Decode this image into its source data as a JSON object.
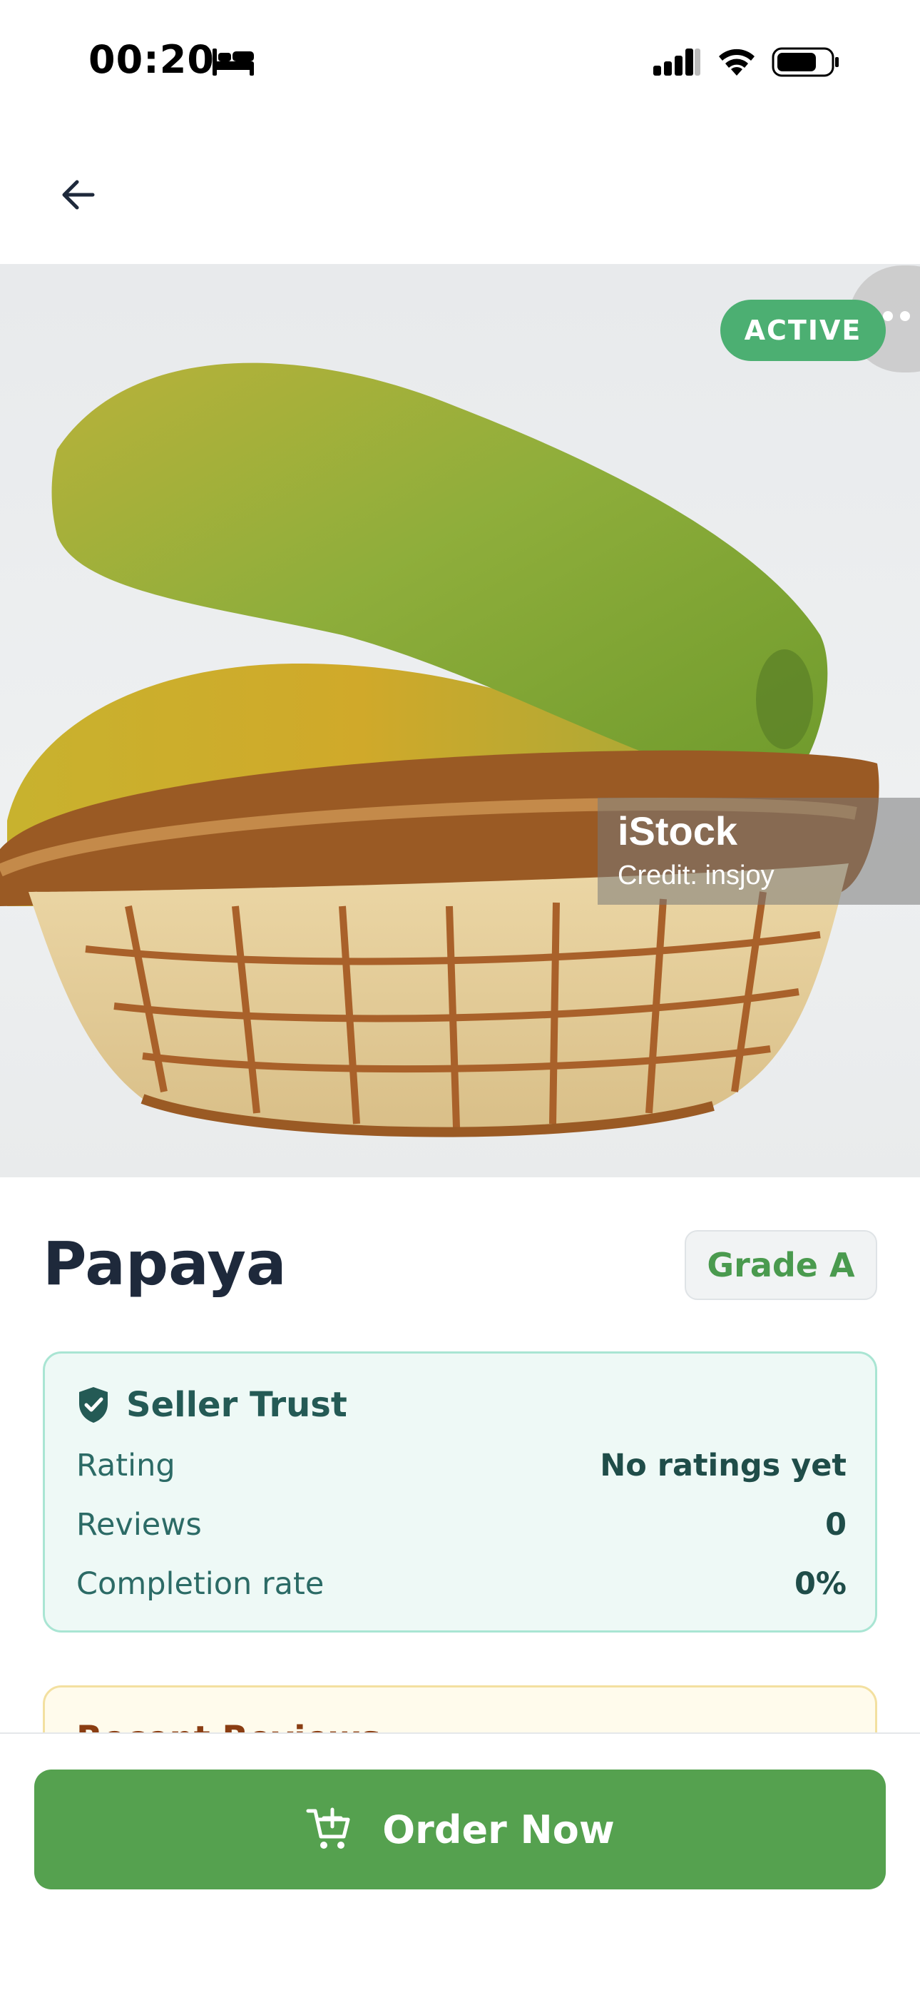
{
  "status_bar": {
    "time": "00:20",
    "icons": [
      "bed-icon",
      "signal-icon",
      "wifi-icon",
      "battery-icon"
    ]
  },
  "header": {
    "back_icon": "arrow-left-icon"
  },
  "product": {
    "image_badge": "ACTIVE",
    "more_icon": "more-dots-icon",
    "watermark_brand": "iStock",
    "watermark_credit": "Credit: insjoy",
    "name": "Papaya",
    "grade": "Grade A"
  },
  "seller_trust": {
    "title": "Seller Trust",
    "icon": "shield-check-icon",
    "rows": [
      {
        "label": "Rating",
        "value": "No ratings yet"
      },
      {
        "label": "Reviews",
        "value": "0"
      },
      {
        "label": "Completion rate",
        "value": "0%"
      }
    ]
  },
  "reviews": {
    "title": "Recent Reviews"
  },
  "footer": {
    "order_label": "Order Now",
    "order_icon": "cart-plus-icon"
  },
  "colors": {
    "primary_green": "#55a14f",
    "active_badge": "#4caf72",
    "grade_text": "#4a9a4e",
    "trust_bg": "#eef9f6",
    "trust_border": "#a9e5d3",
    "reviews_bg": "#fffbec",
    "reviews_title": "#8a3d12"
  }
}
